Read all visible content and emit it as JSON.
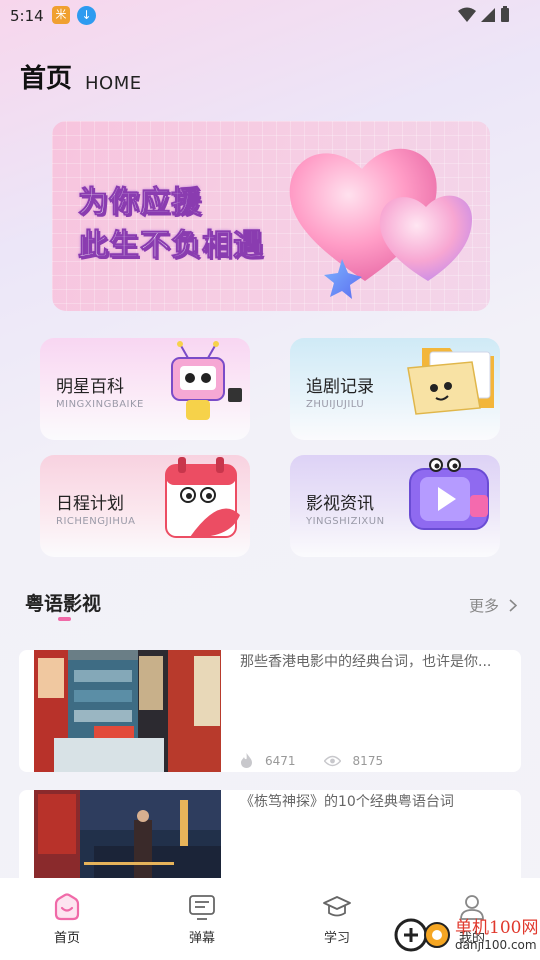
{
  "status_bar": {
    "time": "5:14",
    "badge_1": "米"
  },
  "header": {
    "title": "首页",
    "subtitle": "HOME"
  },
  "banner": {
    "line1": "为你应援",
    "line2": "此生不负相遇"
  },
  "categories": [
    {
      "title": "明星百科",
      "subtitle": "MINGXINGBAIKE"
    },
    {
      "title": "追剧记录",
      "subtitle": "ZHUIJUJILU"
    },
    {
      "title": "日程计划",
      "subtitle": "RICHENGJIHUA"
    },
    {
      "title": "影视资讯",
      "subtitle": "YINGSHIZIXUN"
    }
  ],
  "section": {
    "title": "粤语影视",
    "more_label": "更多"
  },
  "articles": [
    {
      "title": "那些香港电影中的经典台词，也许是你...",
      "likes": "6471",
      "views": "8175"
    },
    {
      "title": "《栋笃神探》的10个经典粤语台词"
    }
  ],
  "bottom_nav": [
    {
      "label": "首页",
      "icon": "home-icon",
      "active": true
    },
    {
      "label": "弹幕",
      "icon": "barrage-icon"
    },
    {
      "label": "学习",
      "icon": "study-cap-icon"
    },
    {
      "label": "我的",
      "icon": "profile-icon"
    }
  ],
  "watermark": {
    "text_cn": "单机100网",
    "text_url": "danji100.com"
  },
  "colors": {
    "accent": "#f06aa8",
    "banner_text": "#ffffff",
    "banner_stroke": "#8a3cb0"
  }
}
